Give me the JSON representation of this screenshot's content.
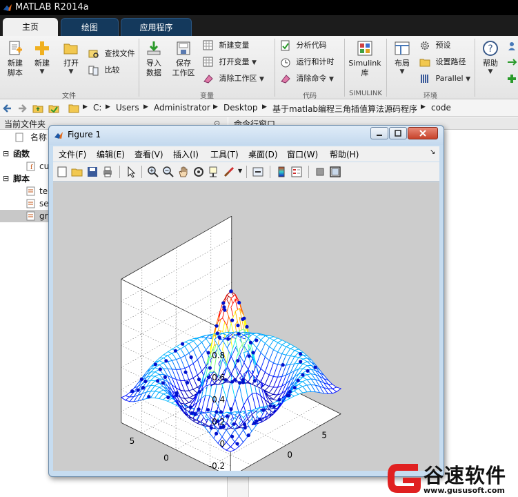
{
  "window": {
    "title": "MATLAB R2014a"
  },
  "tabs": [
    "主页",
    "绘图",
    "应用程序"
  ],
  "ribbon": {
    "new_script": "新建\n脚本",
    "new": "新建",
    "open": "打开",
    "find_files": "查找文件",
    "compare": "比较",
    "import_data": "导入\n数据",
    "save_workspace": "保存\n工作区",
    "new_variable": "新建变量",
    "open_variable": "打开变量",
    "clear_workspace": "清除工作区",
    "analyze_code": "分析代码",
    "run_and_time": "运行和计时",
    "clear_commands": "清除命令",
    "simulink_library": "Simulink\n库",
    "layout": "布局",
    "preferences": "预设",
    "set_path": "设置路径",
    "parallel": "Parallel",
    "help": "帮助",
    "groups": {
      "file": "文件",
      "variable": "变量",
      "code": "代码",
      "simulink": "SIMULINK",
      "environment": "环境"
    }
  },
  "address": {
    "crumbs": [
      "C:",
      "Users",
      "Administrator",
      "Desktop",
      "基于matlab编程三角插值算法源码程序",
      "code"
    ]
  },
  "current_folder": {
    "header": "当前文件夹",
    "column_name": "名称",
    "groups": {
      "functions": "函数",
      "scripts": "脚本"
    },
    "files": {
      "function_file": "cu",
      "script1": "te",
      "script2": "se",
      "script3": "gr"
    }
  },
  "command_window": {
    "header": "命令行窗口"
  },
  "figure": {
    "title": "Figure 1",
    "menus": [
      "文件(F)",
      "编辑(E)",
      "查看(V)",
      "插入(I)",
      "工具(T)",
      "桌面(D)",
      "窗口(W)",
      "帮助(H)"
    ]
  },
  "chart_data": {
    "type": "surface",
    "title": "",
    "xlabel": "",
    "ylabel": "",
    "zlabel": "",
    "xlim": [
      -8,
      8
    ],
    "ylim": [
      -8,
      8
    ],
    "zlim": [
      -0.3,
      1.0
    ],
    "z_ticks": [
      "0.8",
      "0.6",
      "0.4",
      "0.2",
      "0",
      "-0.2"
    ],
    "x_ticks": [
      "-5",
      "0",
      "5"
    ],
    "y_ticks": [
      "-5",
      "0",
      "5"
    ],
    "grid": true,
    "colormap": "jet",
    "surface_function": "sinc(r) = sin(r)/r",
    "scatter_marker_color": "#0010cc",
    "peak_value": 0.85
  },
  "watermark": {
    "name": "谷速软件",
    "url": "www.gususoft.com"
  },
  "colors": {
    "ribbon_tab_bar": "#1c1c1c",
    "figure_frame": "#c6dcf0",
    "plot_background": "#cccccc"
  }
}
